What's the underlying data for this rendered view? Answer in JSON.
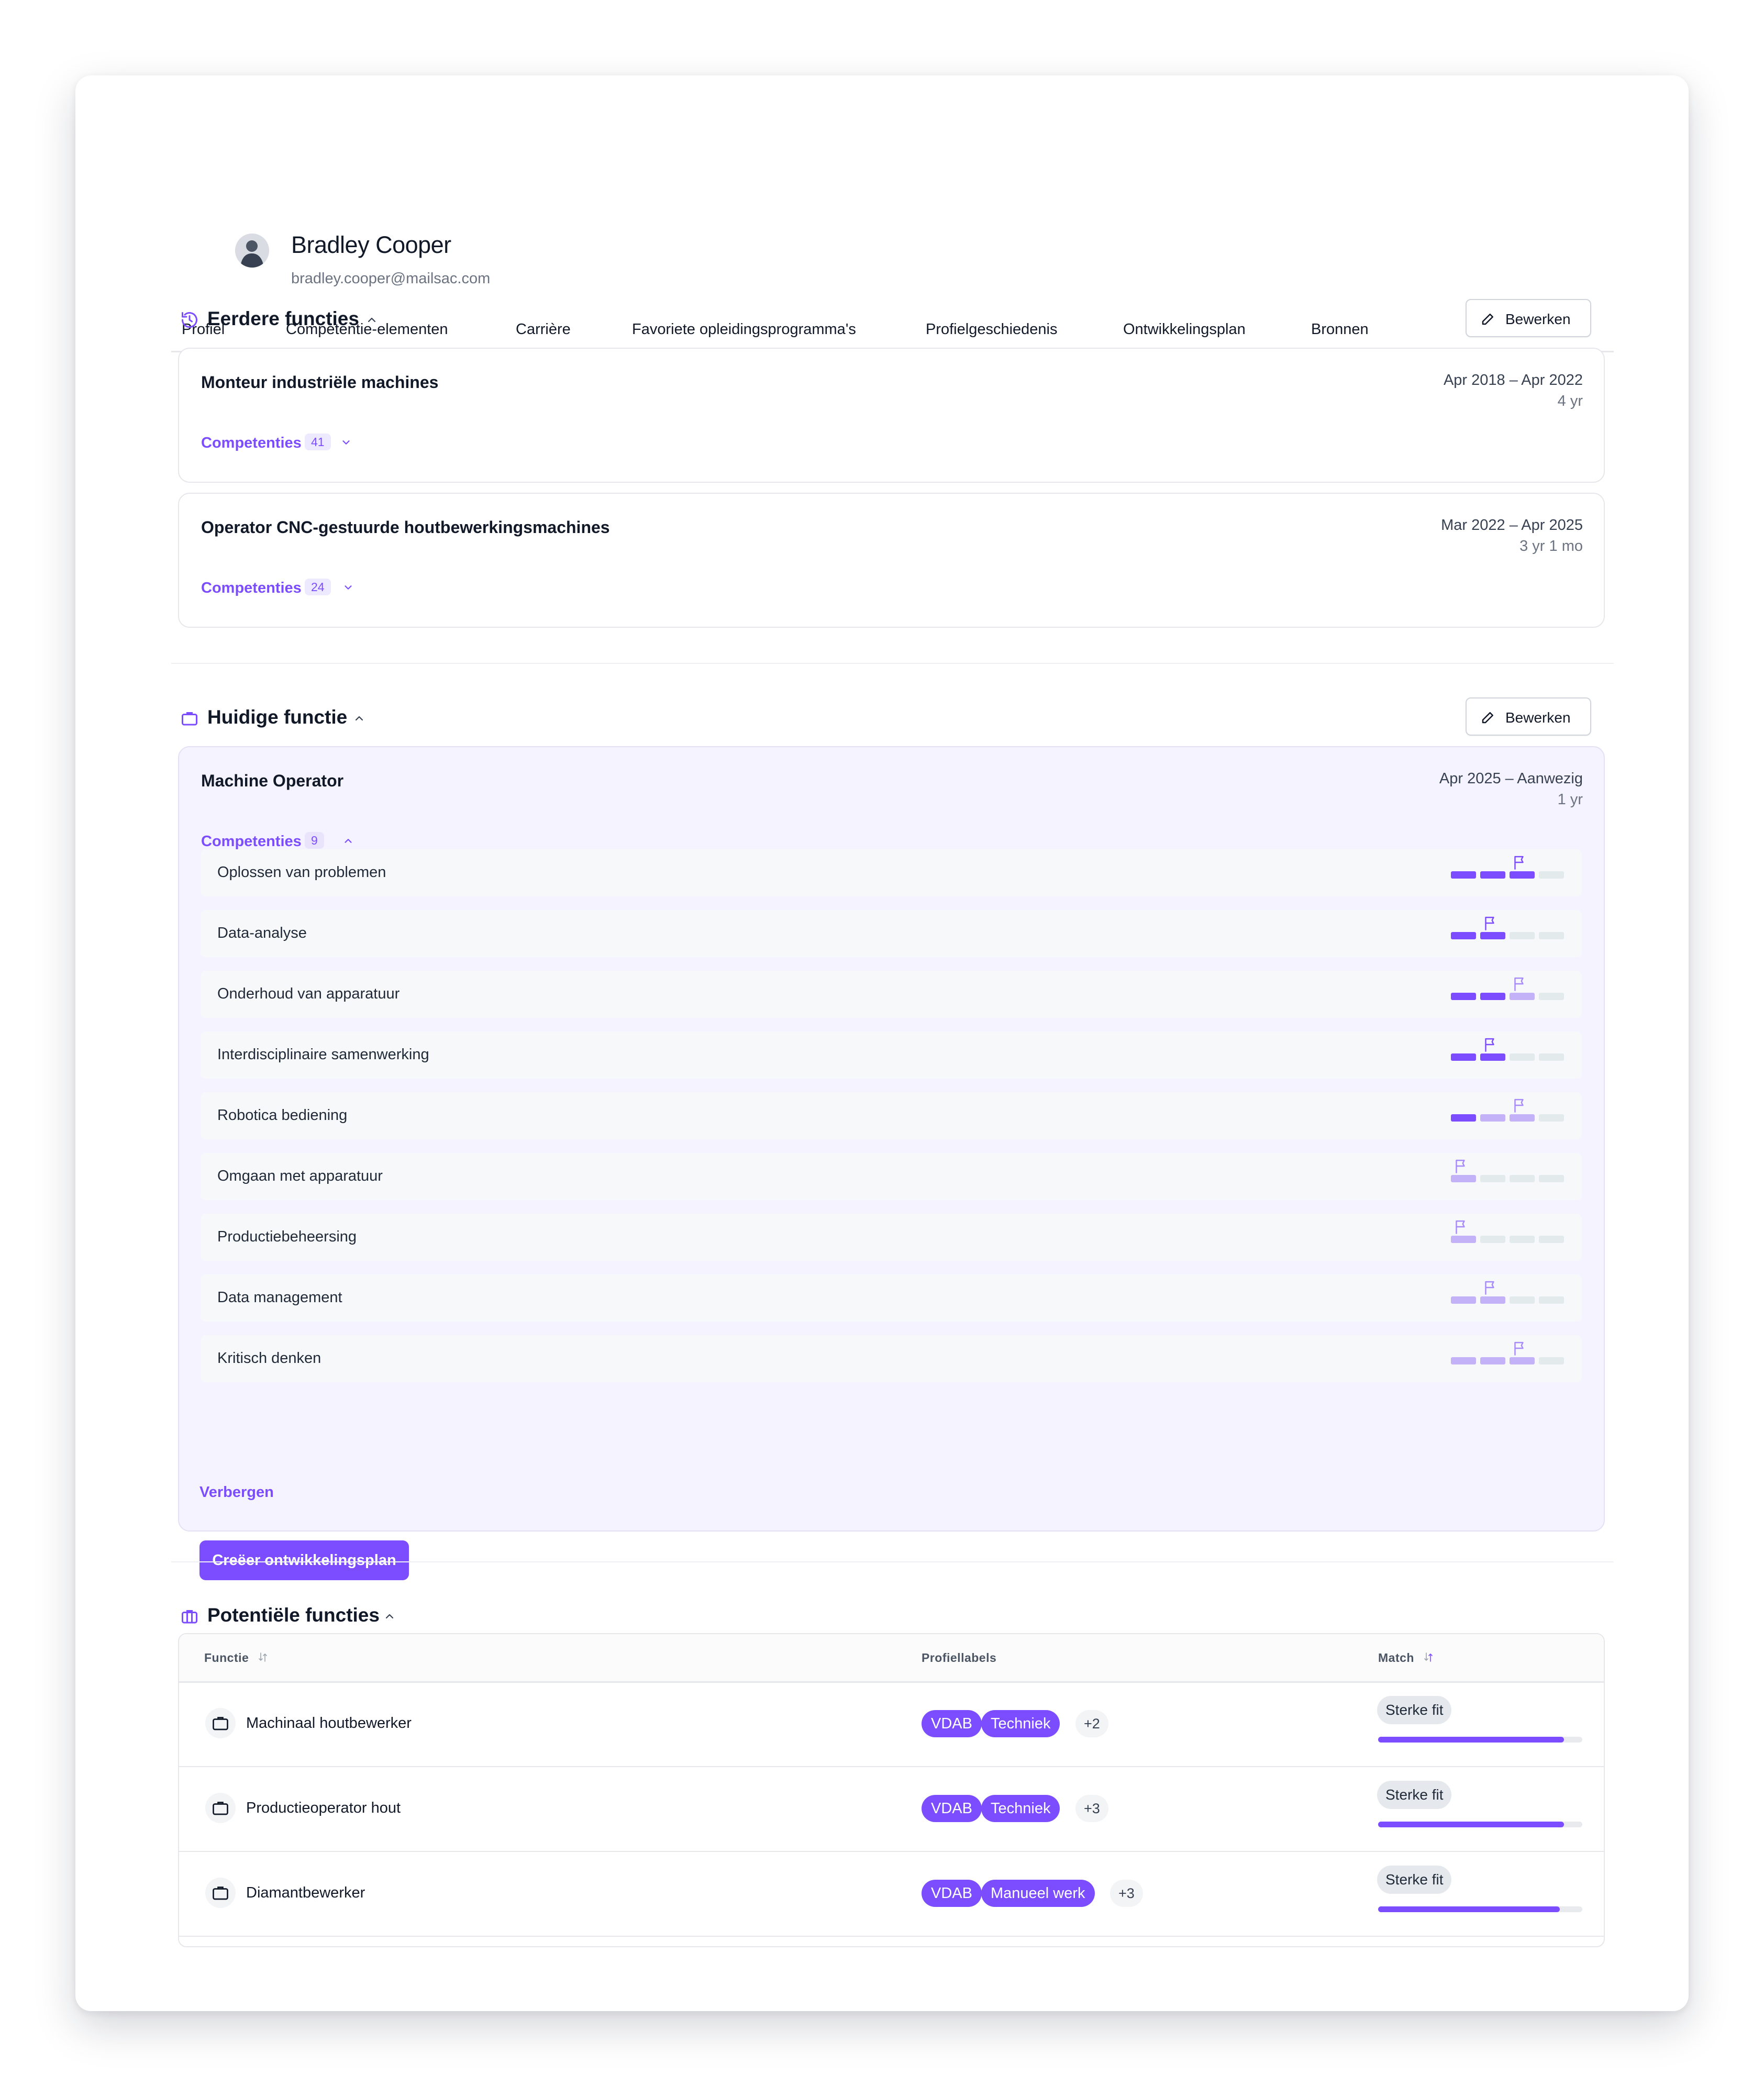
{
  "profile": {
    "name": "Bradley Cooper",
    "email": "bradley.cooper@mailsac.com"
  },
  "tabs": [
    {
      "label": "Profiel"
    },
    {
      "label": "Competentie-elementen"
    },
    {
      "label": "Carrière",
      "active": true
    },
    {
      "label": "Favoriete opleidingsprogramma's"
    },
    {
      "label": "Profielgeschiedenis"
    },
    {
      "label": "Ontwikkelingsplan"
    },
    {
      "label": "Bronnen"
    }
  ],
  "previous": {
    "title": "Eerdere functies",
    "edit_label": "Bewerken",
    "jobs": [
      {
        "title": "Monteur industriële machines",
        "dates": "Apr 2018 – Apr 2022",
        "duration": "4 yr",
        "comp_label": "Competenties",
        "comp_count": "41"
      },
      {
        "title": "Operator CNC-gestuurde houtbewerkingsmachines",
        "dates": "Mar 2022 – Apr 2025",
        "duration": "3 yr 1 mo",
        "comp_label": "Competenties",
        "comp_count": "24"
      }
    ]
  },
  "current": {
    "title": "Huidige functie",
    "edit_label": "Bewerken",
    "job": {
      "title": "Machine Operator",
      "dates": "Apr 2025 – Aanwezig",
      "duration": "1 yr",
      "comp_label": "Competenties",
      "comp_count": "9"
    },
    "competencies": [
      {
        "label": "Oplossen van problemen",
        "level": 3,
        "target": 3
      },
      {
        "label": "Data-analyse",
        "level": 2,
        "target": 2
      },
      {
        "label": "Onderhoud van apparatuur",
        "level": 2,
        "target": 3
      },
      {
        "label": "Interdisciplinaire samenwerking",
        "level": 2,
        "target": 2
      },
      {
        "label": "Robotica bediening",
        "level": 1,
        "target": 3
      },
      {
        "label": "Omgaan met apparatuur",
        "level": 0,
        "target": 1
      },
      {
        "label": "Productiebeheersing",
        "level": 0,
        "target": 1
      },
      {
        "label": "Data management",
        "level": 0,
        "target": 2
      },
      {
        "label": "Kritisch denken",
        "level": 0,
        "target": 3
      }
    ],
    "hide_label": "Verbergen",
    "create_label": "Creëer ontwikkelingsplan"
  },
  "potential": {
    "title": "Potentiële functies",
    "columns": {
      "function": "Functie",
      "labels": "Profiellabels",
      "match": "Match"
    },
    "rows": [
      {
        "name": "Machinaal houtbewerker",
        "tags": [
          "VDAB",
          "Techniek"
        ],
        "more": "+2",
        "fit": "Sterke fit",
        "match": 0.91
      },
      {
        "name": "Productieoperator hout",
        "tags": [
          "VDAB",
          "Techniek"
        ],
        "more": "+3",
        "fit": "Sterke fit",
        "match": 0.91
      },
      {
        "name": "Diamantbewerker",
        "tags": [
          "VDAB",
          "Manueel werk"
        ],
        "more": "+3",
        "fit": "Sterke fit",
        "match": 0.89
      }
    ]
  },
  "colors": {
    "accent": "#7c4dff",
    "accent_light": "#c4b2f8",
    "empty": "#e3eaec"
  }
}
